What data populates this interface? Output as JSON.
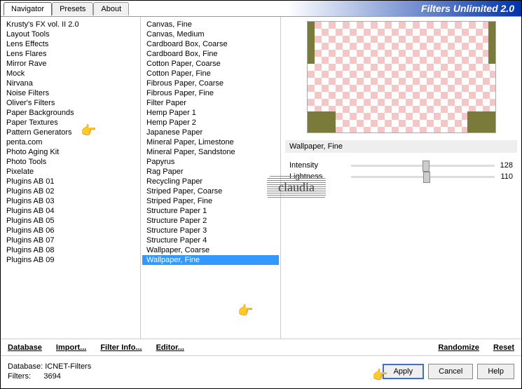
{
  "title": "Filters Unlimited 2.0",
  "tabs": [
    "Navigator",
    "Presets",
    "About"
  ],
  "categories": [
    "Krusty's FX vol. II 2.0",
    "Layout Tools",
    "Lens Effects",
    "Lens Flares",
    "Mirror Rave",
    "Mock",
    "Nirvana",
    "Noise Filters",
    "Oliver's Filters",
    "Paper Backgrounds",
    "Paper Textures",
    "Pattern Generators",
    "penta.com",
    "Photo Aging Kit",
    "Photo Tools",
    "Pixelate",
    "Plugins AB 01",
    "Plugins AB 02",
    "Plugins AB 03",
    "Plugins AB 04",
    "Plugins AB 05",
    "Plugins AB 06",
    "Plugins AB 07",
    "Plugins AB 08",
    "Plugins AB 09"
  ],
  "filters_list": [
    "Canvas, Fine",
    "Canvas, Medium",
    "Cardboard Box, Coarse",
    "Cardboard Box, Fine",
    "Cotton Paper, Coarse",
    "Cotton Paper, Fine",
    "Fibrous Paper, Coarse",
    "Fibrous Paper, Fine",
    "Filter Paper",
    "Hemp Paper 1",
    "Hemp Paper 2",
    "Japanese Paper",
    "Mineral Paper, Limestone",
    "Mineral Paper, Sandstone",
    "Papyrus",
    "Rag Paper",
    "Recycling Paper",
    "Striped Paper, Coarse",
    "Striped Paper, Fine",
    "Structure Paper 1",
    "Structure Paper 2",
    "Structure Paper 3",
    "Structure Paper 4",
    "Wallpaper, Coarse",
    "Wallpaper, Fine"
  ],
  "selected_filter": "Wallpaper, Fine",
  "params": [
    {
      "label": "Intensity",
      "value": "128"
    },
    {
      "label": "Lightness",
      "value": "110"
    }
  ],
  "links": {
    "database": "Database",
    "import": "Import...",
    "filterinfo": "Filter Info...",
    "editor": "Editor...",
    "randomize": "Randomize",
    "reset": "Reset"
  },
  "meta": {
    "db_label": "Database:",
    "db_val": "ICNET-Filters",
    "filters_label": "Filters:",
    "filters_val": "3694"
  },
  "buttons": {
    "apply": "Apply",
    "cancel": "Cancel",
    "help": "Help"
  },
  "watermark": "claudia"
}
